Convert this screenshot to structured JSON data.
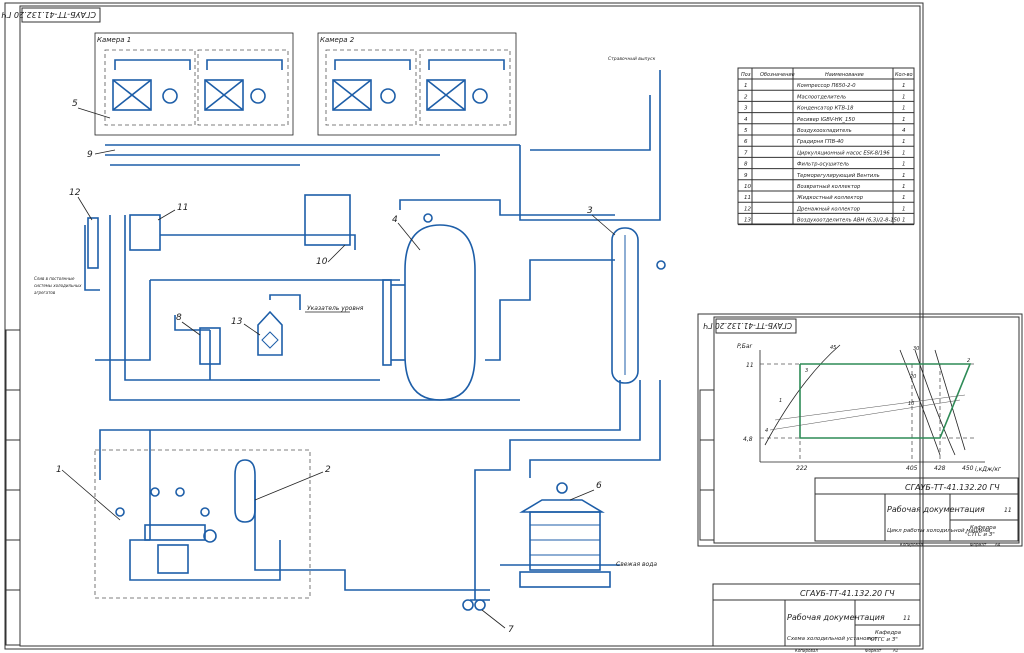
{
  "sheet": {
    "code": "СГАУБ-ТТ-41.132.20 ГЧ",
    "doc_type": "Рабочая документация",
    "title": "Схема холодильной установки",
    "dept_line1": "Кафедра",
    "dept_line2": "\"СТГС и З\"",
    "sheet_count": "11",
    "copied": "Копировал",
    "format": "Формат",
    "format_value": "А1"
  },
  "spec": {
    "headers": [
      "Поз",
      "Обозначение",
      "Наименование",
      "Кол-во"
    ],
    "rows": [
      {
        "pos": "1",
        "name": "Компрессор П650-2-0",
        "qty": "1"
      },
      {
        "pos": "2",
        "name": "Маслоотделитель",
        "qty": "1"
      },
      {
        "pos": "3",
        "name": "Конденсатор КТВ-18",
        "qty": "1"
      },
      {
        "pos": "4",
        "name": "Ресивер IGBV-НК_150",
        "qty": "1"
      },
      {
        "pos": "5",
        "name": "Воздухоохладитель",
        "qty": "4"
      },
      {
        "pos": "6",
        "name": "Градирня ГПВ-40",
        "qty": "1"
      },
      {
        "pos": "7",
        "name": "Циркуляционный насос ESK-8/196",
        "qty": "1"
      },
      {
        "pos": "8",
        "name": "Фильтр-осушитель",
        "qty": "1"
      },
      {
        "pos": "9",
        "name": "Терморегулирующий Вентиль",
        "qty": "1"
      },
      {
        "pos": "10",
        "name": "Возвратный коллектор",
        "qty": "1"
      },
      {
        "pos": "11",
        "name": "Жидкостный коллектор",
        "qty": "1"
      },
      {
        "pos": "12",
        "name": "Дренажный коллектор",
        "qty": "1"
      },
      {
        "pos": "13",
        "name": "Воздухоотделитель АВН (6,3)/2-8-150",
        "qty": "1"
      }
    ]
  },
  "chambers": [
    {
      "label": "Камера 1"
    },
    {
      "label": "Камера 2"
    }
  ],
  "labels": {
    "level_indicator": "Указатель уровня",
    "fresh_water": "Свежая вода",
    "vent": "Стравочный выпуск",
    "drain_note_1": "Слив в постоянные",
    "drain_note_2": "системы холодильных",
    "drain_note_3": "агрегатов"
  },
  "callouts": [
    "1",
    "2",
    "3",
    "4",
    "5",
    "6",
    "7",
    "8",
    "9",
    "10",
    "11",
    "12",
    "13"
  ],
  "cycle": {
    "sheet_code": "СГАУБ-ТТ-41.132.20 ГЧ",
    "doc_type": "Рабочая документация",
    "title": "Цикл работы холодильной машины",
    "dept_line1": "Кафедра",
    "dept_line2": "\"СТГС и З\"",
    "sheet_no": "11",
    "copied": "Копировал",
    "format": "Формат",
    "format_value": "А4",
    "ylabel": "P,Бar",
    "xlabel": "i,кДж/кг",
    "y_ticks": [
      "11",
      "4,8"
    ],
    "x_ticks": [
      "222",
      "405",
      "428",
      "450"
    ],
    "point_labels": [
      "1",
      "2",
      "3",
      "4",
      "5",
      "6",
      "7",
      "8",
      "9",
      "10",
      "20",
      "30",
      "45"
    ]
  },
  "colors": {
    "line": "#1d5ea8",
    "frame": "#333333",
    "green": "#2e8b57"
  }
}
